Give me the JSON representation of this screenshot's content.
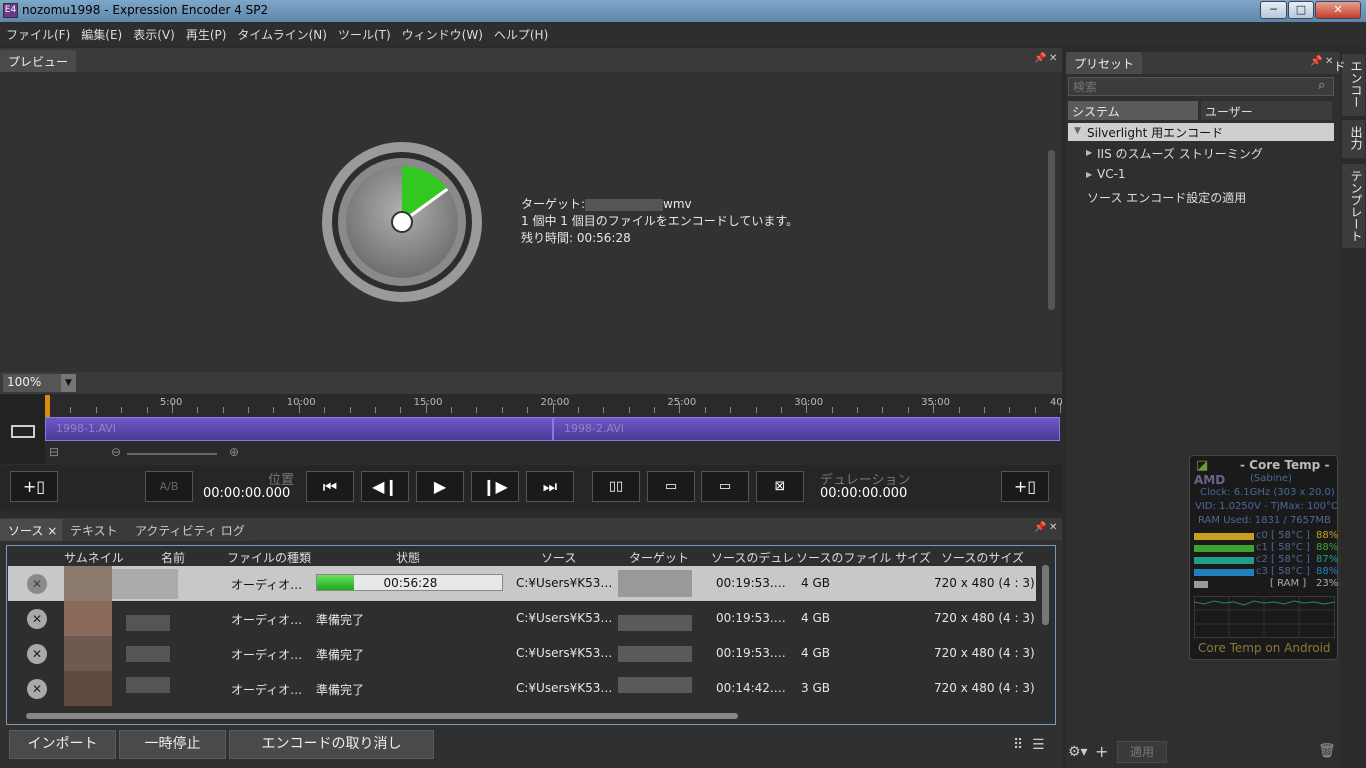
{
  "window": {
    "title": "nozomu1998 - Expression Encoder 4 SP2",
    "app_icon": "E4",
    "controls": [
      "─",
      "□",
      "✕"
    ]
  },
  "menu": [
    "ファイル(F)",
    "編集(E)",
    "表示(V)",
    "再生(P)",
    "タイムライン(N)",
    "ツール(T)",
    "ウィンドウ(W)",
    "ヘルプ(H)"
  ],
  "preview": {
    "tab": "プレビュー",
    "progress": 0.15,
    "target_label": "ターゲット:",
    "target_ext": "wmv",
    "file_progress": "1 個中 1 個目のファイルをエンコードしています。",
    "remaining": "残り時間: 00:56:28",
    "zoom": "100%"
  },
  "timeline": {
    "ticks": [
      "5:00",
      "10:00",
      "15:00",
      "20:00",
      "25:00",
      "30:00",
      "35:00",
      "40"
    ],
    "clips": [
      "1998-1.AVI",
      "1998-2.AVI"
    ]
  },
  "transport": {
    "ab": "A/B",
    "position_label": "位置",
    "position": "00:00:00.000",
    "duration_label": "デュレーション",
    "duration": "00:00:00.000"
  },
  "source_panel": {
    "tabs": [
      "ソース",
      "テキスト",
      "アクティビティ ログ"
    ],
    "columns": [
      "サムネイル",
      "名前",
      "ファイルの種類",
      "状態",
      "ソース",
      "ターゲット",
      "ソースのデュレ",
      "ソースのファイル サイズ",
      "ソースのサイズ"
    ],
    "rows": [
      {
        "type": "オーディオ…",
        "status": "00:56:28",
        "progress": 0.2,
        "source": "C:¥Users¥K53…",
        "duration": "00:19:53.…",
        "filesize": "4 GB",
        "size": "720 x 480 (4 : 3)"
      },
      {
        "type": "オーディオ…",
        "status": "準備完了",
        "source": "C:¥Users¥K53…",
        "duration": "00:19:53.…",
        "filesize": "4 GB",
        "size": "720 x 480 (4 : 3)"
      },
      {
        "type": "オーディオ…",
        "status": "準備完了",
        "source": "C:¥Users¥K53…",
        "duration": "00:19:53.…",
        "filesize": "4 GB",
        "size": "720 x 480 (4 : 3)"
      },
      {
        "type": "オーディオ…",
        "status": "準備完了",
        "source": "C:¥Users¥K53…",
        "duration": "00:14:42.…",
        "filesize": "3 GB",
        "size": "720 x 480 (4 : 3)"
      }
    ],
    "buttons": [
      "インポート",
      "一時停止",
      "エンコードの取り消し"
    ]
  },
  "preset": {
    "tab": "プリセット",
    "search_placeholder": "検索",
    "subtabs": [
      "システム",
      "ユーザー"
    ],
    "tree": [
      "Silverlight 用エンコード",
      "IIS のスムーズ ストリーミング",
      "VC-1",
      "ソース エンコード設定の適用"
    ],
    "apply": "適用"
  },
  "side_tabs": [
    "エンコード",
    "出力",
    "テンプレート"
  ],
  "coretemp": {
    "title": "- Core Temp -",
    "brand": "AMD",
    "codename": "(Sabine)",
    "clock": "Clock: 6.1GHz (303 x 20.0)",
    "vid": "VID: 1.0250V - TjMax: 100°C",
    "ram": "RAM Used: 1831 / 7657MB",
    "cores": [
      {
        "label": "c0 [ 58°C ]",
        "pct": "88%",
        "color": "#c8a020"
      },
      {
        "label": "c1 [ 58°C ]",
        "pct": "88%",
        "color": "#40a030"
      },
      {
        "label": "c2 [ 58°C ]",
        "pct": "87%",
        "color": "#20a088"
      },
      {
        "label": "c3 [ 58°C ]",
        "pct": "88%",
        "color": "#2080c0"
      }
    ],
    "ram_label": "[ RAM ]",
    "ram_pct": "23%",
    "footer": "Core Temp on Android"
  }
}
